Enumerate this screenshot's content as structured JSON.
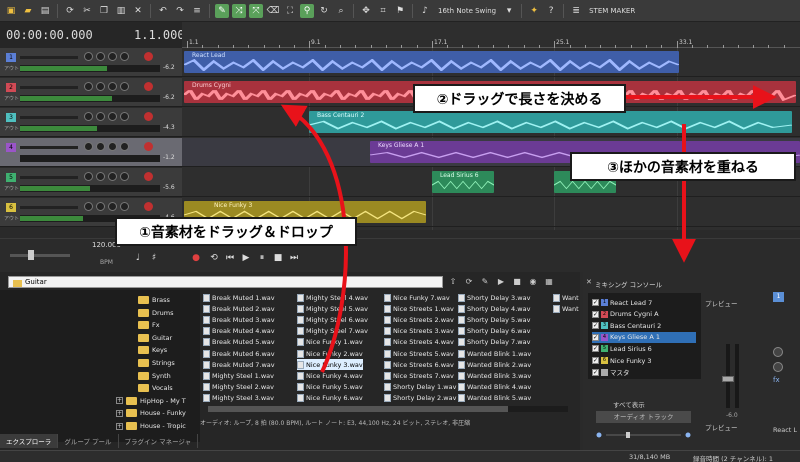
{
  "toolbar": {
    "swing_label": "16th Note Swing",
    "stem_label": "STEM MAKER"
  },
  "timecode": {
    "time": "00:00:00.000",
    "beat": "1.1.000"
  },
  "ruler": {
    "markers": [
      "1.1",
      "9.1",
      "17.1",
      "25.1",
      "33.1"
    ]
  },
  "tracks": [
    {
      "num": "1",
      "color": "#5b7fd6",
      "volume": "-6.2",
      "out_label": "アウト",
      "meter": 0.62
    },
    {
      "num": "2",
      "color": "#d14a55",
      "volume": "-6.2",
      "out_label": "アウト",
      "meter": 0.66
    },
    {
      "num": "3",
      "color": "#4fc0c0",
      "volume": "-4.3",
      "out_label": "アウト",
      "meter": 0.55
    },
    {
      "num": "4",
      "color": "#9a55c8",
      "volume": "-1.2",
      "out_label": "",
      "meter": 0.0
    },
    {
      "num": "5",
      "color": "#3fb070",
      "volume": "-5.6",
      "out_label": "アウト",
      "meter": 0.5
    },
    {
      "num": "6",
      "color": "#d8c040",
      "volume": "-4.6",
      "out_label": "アウト",
      "meter": 0.45
    }
  ],
  "clips": {
    "react_lead": "React Lead",
    "drums_cygni": "Drums Cygni",
    "bass_centauri": "Bass Centauri 2",
    "keys_gliese": "Keys Gliese A 1",
    "lead_sirius": "Lead Sirius 6",
    "nice_funky": "Nice Funky 3"
  },
  "transport": {
    "bpm_value": "120.000",
    "bpm_label": "BPM"
  },
  "explorer": {
    "path": "Guitar",
    "folders": [
      "Brass",
      "Drums",
      "Fx",
      "Guitar",
      "Keys",
      "Strings",
      "Synth",
      "Vocals",
      "HipHop - My T",
      "House - Funky",
      "House - Tropic"
    ],
    "files": [
      [
        "Break Muted 1.wav",
        "Break Muted 2.wav",
        "Break Muted 3.wav",
        "Break Muted 4.wav",
        "Break Muted 5.wav",
        "Break Muted 6.wav",
        "Break Muted 7.wav",
        "Mighty Steel 1.wav",
        "Mighty Steel 2.wav",
        "Mighty Steel 3.wav"
      ],
      [
        "Mighty Steel 4.wav",
        "Mighty Steel 5.wav",
        "Mighty Steel 6.wav",
        "Mighty Steel 7.wav",
        "Nice Funky 1.wav",
        "Nice Funky 2.wav",
        "Nice Funky 3.wav",
        "Nice Funky 4.wav",
        "Nice Funky 5.wav",
        "Nice Funky 6.wav"
      ],
      [
        "Nice Funky 7.wav",
        "Nice Streets 1.wav",
        "Nice Streets 2.wav",
        "Nice Streets 3.wav",
        "Nice Streets 4.wav",
        "Nice Streets 5.wav",
        "Nice Streets 6.wav",
        "Nice Streets 7.wav",
        "Shorty Delay 1.wav",
        "Shorty Delay 2.wav"
      ],
      [
        "Shorty Delay 3.wav",
        "Shorty Delay 4.wav",
        "Shorty Delay 5.wav",
        "Shorty Delay 6.wav",
        "Shorty Delay 7.wav",
        "Wanted Blink 1.wav",
        "Wanted Blink 2.wav",
        "Wanted Blink 3.wav",
        "Wanted Blink 4.wav",
        "Wanted Blink 5.wav"
      ],
      [
        "Want",
        "Want"
      ]
    ],
    "status": "オーディオ: ループ, 8 拍 (80.0 BPM), ルート ノート: E3, 44,100 Hz, 24 ビット, ステレオ, 非圧縮",
    "tabs": [
      "エクスプローラ",
      "グループ プール",
      "プラグイン マネージャ"
    ]
  },
  "mixer": {
    "title": "ミキシング コンソール",
    "items": [
      "React Lead 7",
      "Drums Cygni A",
      "Bass Centauri 2",
      "Keys Gliese A 1",
      "Lead Sirius 6",
      "Nice Funky 3",
      "マスタ"
    ],
    "item_numbers": [
      "1",
      "2",
      "3",
      "4",
      "5",
      "6",
      ""
    ],
    "item_colors": [
      "#5b7fd6",
      "#d14a55",
      "#4fc0c0",
      "#9a55c8",
      "#3fb070",
      "#d8c040",
      "#aaaaaa"
    ],
    "show_all": "すべて表示",
    "audio_track": "オーディオ トラック",
    "preview": "プレビュー",
    "preview2": "プレビュー",
    "react_label": "React L",
    "db_value": "-6.0",
    "channel": "1"
  },
  "statusbar": {
    "memory": "31/8,140 MB",
    "record_time": "録音時間 (2 チャンネル): 1"
  },
  "callouts": {
    "c1": "①音素材をドラッグ＆ドロップ",
    "c2": "②ドラッグで長さを決める",
    "c3": "③ほかの音素材を重ねる"
  },
  "colors": {
    "arrow_red": "#e8121a"
  }
}
